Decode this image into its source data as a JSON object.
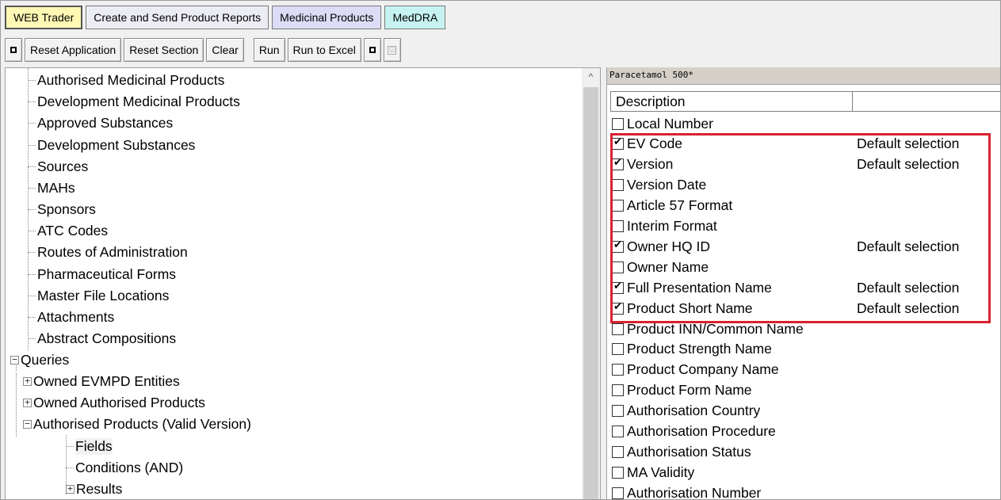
{
  "app_tabs": [
    {
      "label": "WEB Trader",
      "style": "yellow"
    },
    {
      "label": "Create and Send Product Reports",
      "style": "plain"
    },
    {
      "label": "Medicinal Products",
      "style": "lav"
    },
    {
      "label": "MedDRA",
      "style": "cyan"
    }
  ],
  "toolbar": {
    "reset_application": "Reset Application",
    "reset_section": "Reset Section",
    "clear": "Clear",
    "run": "Run",
    "run_to_excel": "Run to Excel",
    "check_glyph": "☑"
  },
  "tree": {
    "items": [
      {
        "label": "Authorised Medicinal Products"
      },
      {
        "label": "Development Medicinal Products"
      },
      {
        "label": "Approved Substances"
      },
      {
        "label": "Development Substances"
      },
      {
        "label": "Sources"
      },
      {
        "label": "MAHs"
      },
      {
        "label": "Sponsors"
      },
      {
        "label": "ATC Codes"
      },
      {
        "label": "Routes of Administration"
      },
      {
        "label": "Pharmaceutical Forms"
      },
      {
        "label": "Master File Locations"
      },
      {
        "label": "Attachments"
      },
      {
        "label": "Abstract Compositions"
      },
      {
        "label": "Queries",
        "expander": "−"
      },
      {
        "label": "Owned EVMPD Entities",
        "expander": "+"
      },
      {
        "label": "Owned Authorised Products",
        "expander": "+"
      },
      {
        "label": "Authorised Products (Valid Version)",
        "expander": "−"
      },
      {
        "label": "Fields"
      },
      {
        "label": "Conditions (AND)"
      },
      {
        "label": "Results",
        "expander": "+"
      }
    ],
    "scroll_up": "^"
  },
  "fields_panel": {
    "query_title": "Paracetamol 500*",
    "column_header": "Description",
    "rows": [
      {
        "label": "Local Number",
        "checked": false,
        "note": ""
      },
      {
        "label": "EV Code",
        "checked": true,
        "note": "Default selection"
      },
      {
        "label": "Version",
        "checked": true,
        "note": "Default selection"
      },
      {
        "label": "Version Date",
        "checked": false,
        "note": ""
      },
      {
        "label": "Article 57 Format",
        "checked": false,
        "note": ""
      },
      {
        "label": "Interim Format",
        "checked": false,
        "note": ""
      },
      {
        "label": "Owner HQ ID",
        "checked": true,
        "note": "Default selection"
      },
      {
        "label": "Owner Name",
        "checked": false,
        "note": ""
      },
      {
        "label": "Full Presentation Name",
        "checked": true,
        "note": "Default selection"
      },
      {
        "label": "Product Short Name",
        "checked": true,
        "note": "Default selection"
      },
      {
        "label": "Product INN/Common Name",
        "checked": false,
        "note": ""
      },
      {
        "label": "Product Strength Name",
        "checked": false,
        "note": ""
      },
      {
        "label": "Product Company Name",
        "checked": false,
        "note": ""
      },
      {
        "label": "Product Form Name",
        "checked": false,
        "note": ""
      },
      {
        "label": "Authorisation Country",
        "checked": false,
        "note": ""
      },
      {
        "label": "Authorisation Procedure",
        "checked": false,
        "note": ""
      },
      {
        "label": "Authorisation Status",
        "checked": false,
        "note": ""
      },
      {
        "label": "MA Validity",
        "checked": false,
        "note": ""
      },
      {
        "label": "Authorisation Number",
        "checked": false,
        "note": ""
      }
    ]
  },
  "colors": {
    "highlight_border": "#d9222f",
    "webtrader_tab": "#fff8b4",
    "medicinal_tab": "#dcdcf6",
    "meddra_tab": "#c6f3f1"
  }
}
